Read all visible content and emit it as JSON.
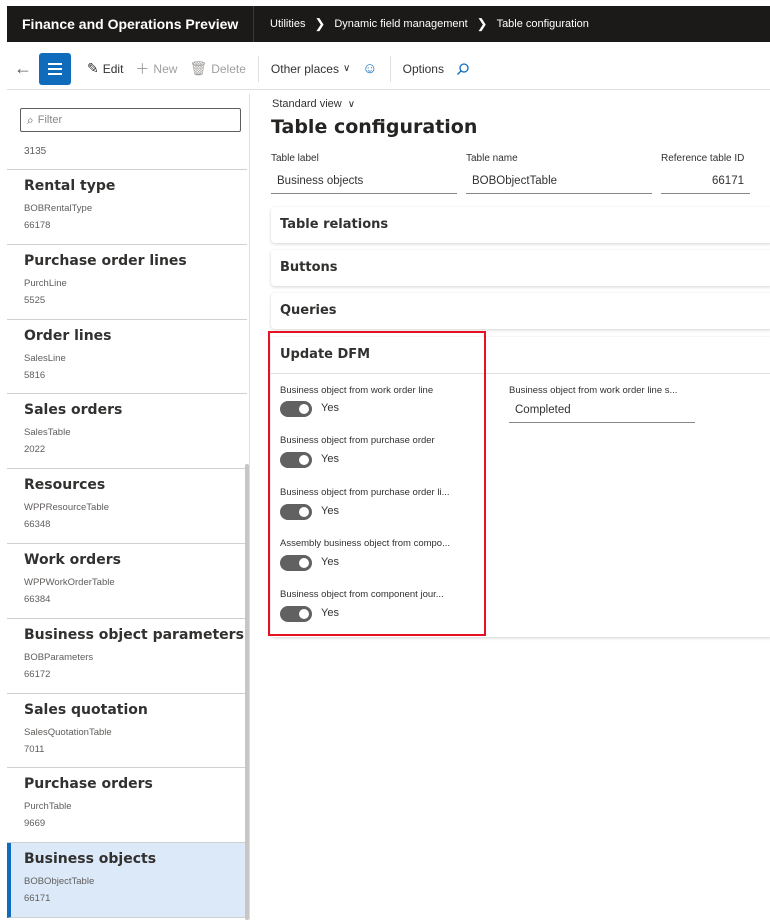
{
  "app": {
    "title": "Finance and Operations Preview"
  },
  "breadcrumb": [
    "Utilities",
    "Dynamic field management",
    "Table configuration"
  ],
  "toolbar": {
    "edit": "Edit",
    "new": "New",
    "delete": "Delete",
    "other_places": "Other places",
    "options": "Options"
  },
  "left": {
    "filter_placeholder": "Filter",
    "top_value": "3135",
    "items": [
      {
        "title": "Rental type",
        "table": "BOBRentalType",
        "id": "66178"
      },
      {
        "title": "Purchase order lines",
        "table": "PurchLine",
        "id": "5525"
      },
      {
        "title": "Order lines",
        "table": "SalesLine",
        "id": "5816"
      },
      {
        "title": "Sales orders",
        "table": "SalesTable",
        "id": "2022"
      },
      {
        "title": "Resources",
        "table": "WPPResourceTable",
        "id": "66348"
      },
      {
        "title": "Work orders",
        "table": "WPPWorkOrderTable",
        "id": "66384"
      },
      {
        "title": "Business object parameters",
        "table": "BOBParameters",
        "id": "66172"
      },
      {
        "title": "Sales quotation",
        "table": "SalesQuotationTable",
        "id": "7011"
      },
      {
        "title": "Purchase orders",
        "table": "PurchTable",
        "id": "9669"
      },
      {
        "title": "Business objects",
        "table": "BOBObjectTable",
        "id": "66171",
        "selected": true
      }
    ]
  },
  "main": {
    "view": "Standard view",
    "title": "Table configuration",
    "fields": {
      "table_label": {
        "label": "Table label",
        "value": "Business objects"
      },
      "table_name": {
        "label": "Table name",
        "value": "BOBObjectTable"
      },
      "ref_id": {
        "label": "Reference table ID",
        "value": "66171"
      }
    },
    "fasttabs": [
      "Table relations",
      "Buttons",
      "Queries"
    ],
    "dfm": {
      "title": "Update DFM",
      "toggles": [
        {
          "label": "Business object from work order line",
          "value": "Yes"
        },
        {
          "label": "Business object from purchase order",
          "value": "Yes"
        },
        {
          "label": "Business object from purchase order li...",
          "value": "Yes"
        },
        {
          "label": "Assembly business object from compo...",
          "value": "Yes"
        },
        {
          "label": "Business object from component jour...",
          "value": "Yes"
        }
      ],
      "status_field": {
        "label": "Business object from work order line s...",
        "value": "Completed"
      }
    }
  },
  "colors": {
    "accent": "#0f6cbd",
    "highlight": "#e81123",
    "topbar": "#1b1a19"
  }
}
